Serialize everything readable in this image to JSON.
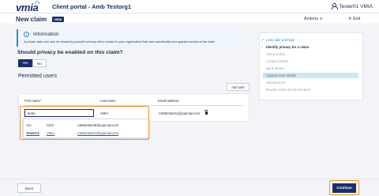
{
  "app": {
    "logo": "vmia",
    "portal_title": "Client portal - Amb Testorg1",
    "user": "Tester01 VMIA"
  },
  "header": {
    "title": "New claim",
    "badge": "NEW",
    "actions_label": "Actions ∨",
    "exit_label": "✕ Exit"
  },
  "info": {
    "icon": "i",
    "title": "Information",
    "text": "A private claim can only be viewed by yourself and any other contact in your organisation that have specifically been granted access to the claim"
  },
  "privacy": {
    "question": "Should privacy be enabled on this claim?",
    "yes_label": "Yes",
    "no_label": "No"
  },
  "permitted": {
    "title": "Permitted users",
    "add_user_label": "Add user",
    "columns": {
      "first": "First name",
      "required_mark": "*",
      "last": "Last name",
      "email": "Email address"
    },
    "row": {
      "first_input": "teste",
      "last": "VMIA",
      "email": "c360tester01@yopmail.com"
    },
    "suggestions": [
      {
        "first": "Arn",
        "last": "CEO",
        "email": "c360tester05@yopmail.com"
      },
      {
        "first": "Tester01",
        "last": "VMIA",
        "email": "c360tester01@yopmail.com"
      }
    ]
  },
  "steps": [
    {
      "label": "Loss date and type",
      "state": "done",
      "mark": "✓"
    },
    {
      "label": "Identify privacy for a claim",
      "state": "current",
      "mark": "›"
    },
    {
      "label": "Select policy",
      "state": "todo",
      "mark": ""
    },
    {
      "label": "Contact details",
      "state": "todo",
      "mark": ""
    },
    {
      "label": "Bank details",
      "state": "todo",
      "mark": ""
    },
    {
      "label": "Capture loss details",
      "state": "active",
      "mark": ""
    },
    {
      "label": "Attachments",
      "state": "todo",
      "mark": ""
    },
    {
      "label": "Review claim and declaration",
      "state": "todo",
      "mark": ""
    }
  ],
  "footer": {
    "back_label": "Back",
    "continue_label": "Continue"
  },
  "colors": {
    "brand": "#1b2d6b",
    "accent": "#2b8ac8",
    "highlight": "#f0932b"
  }
}
